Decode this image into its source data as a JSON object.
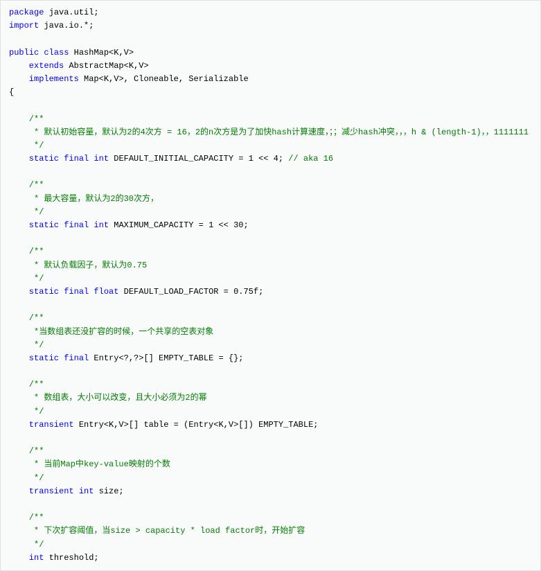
{
  "code": {
    "l1_kw": "package",
    "l1_rest": " java.util;",
    "l2_kw": "import",
    "l2_rest": " java.io.*;",
    "l4a_kw": "public",
    "l4b_kw": " class",
    "l4_rest": " HashMap<K,V>",
    "l5_kw": "    extends",
    "l5_rest": " AbstractMap<K,V>",
    "l6_kw": "    implements",
    "l6_rest": " Map<K,V>, Cloneable, Serializable",
    "l7": "{",
    "c1_open": "    /**",
    "c1_body": "     * 默认初始容量，默认为2的4次方 = 16，2的n次方是为了加快hash计算速度，；；减少hash冲突，，，h & (length-1)，，1111111",
    "c1_close": "     */",
    "s1a_kw": "    static",
    "s1b_kw": " final",
    "s1c_kw": " int",
    "s1_rest": " DEFAULT_INITIAL_CAPACITY = 1 << 4; ",
    "s1_cm": "// aka 16",
    "c2_open": "    /**",
    "c2_body": "     * 最大容量，默认为2的30次方，",
    "c2_close": "     */",
    "s2a_kw": "    static",
    "s2b_kw": " final",
    "s2c_kw": " int",
    "s2_rest": " MAXIMUM_CAPACITY = 1 << 30;",
    "c3_open": "    /**",
    "c3_body": "     * 默认负载因子，默认为0.75",
    "c3_close": "     */",
    "s3a_kw": "    static",
    "s3b_kw": " final",
    "s3c_kw": " float",
    "s3_rest": " DEFAULT_LOAD_FACTOR = 0.75f;",
    "c4_open": "    /**",
    "c4_body": "     *当数组表还没扩容的时候，一个共享的空表对象",
    "c4_close": "     */",
    "s4a_kw": "    static",
    "s4b_kw": " final",
    "s4_rest": " Entry<?,?>[] EMPTY_TABLE = {};",
    "c5_open": "    /**",
    "c5_body": "     * 数组表，大小可以改变，且大小必须为2的幂",
    "c5_close": "     */",
    "s5a_kw": "    transient",
    "s5_rest": " Entry<K,V>[] table = (Entry<K,V>[]) EMPTY_TABLE;",
    "c6_open": "    /**",
    "c6_body": "     * 当前Map中key-value映射的个数",
    "c6_close": "     */",
    "s6a_kw": "    transient",
    "s6b_kw": " int",
    "s6_rest": " size;",
    "c7_open": "    /**",
    "c7_body": "     * 下次扩容阈值，当size > capacity * load factor时，开始扩容",
    "c7_close": "     */",
    "s7a_kw": "    int",
    "s7_rest": " threshold;"
  }
}
